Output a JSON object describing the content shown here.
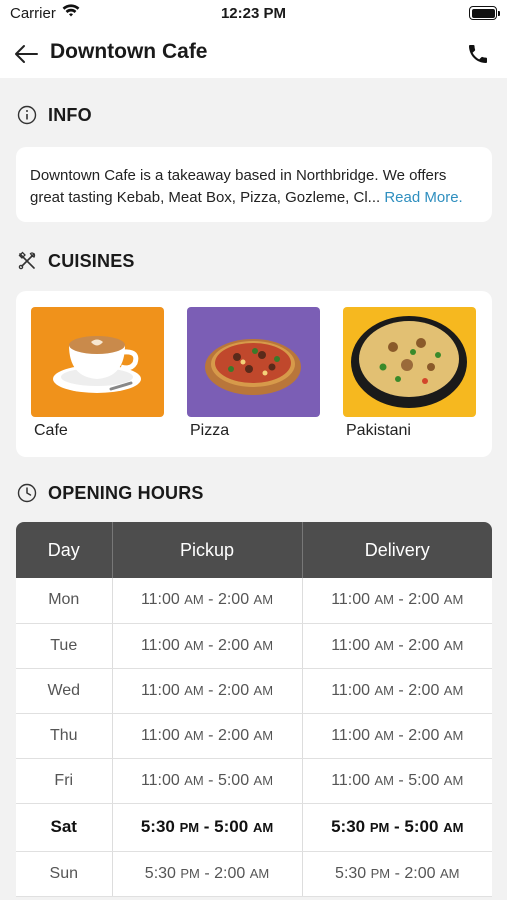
{
  "status": {
    "carrier": "Carrier",
    "time": "12:23 PM"
  },
  "header": {
    "title": "Downtown Cafe",
    "icons": {
      "back": "back-arrow-icon",
      "call": "phone-icon"
    }
  },
  "info": {
    "section_title": "INFO",
    "line1": "Downtown Cafe is a takeaway based in Northbridge. We offers",
    "line2": "great tasting Kebab, Meat Box, Pizza, Gozleme, Cl...",
    "read_more": " Read More."
  },
  "cuisines": {
    "section_title": "CUISINES",
    "items": [
      {
        "label": "Cafe",
        "bg": "#f0921b"
      },
      {
        "label": "Pizza",
        "bg": "#7b5eb5"
      },
      {
        "label": "Pakistani",
        "bg": "#f6b81f"
      }
    ]
  },
  "hours": {
    "section_title": "OPENING HOURS",
    "columns": [
      "Day",
      "Pickup",
      "Delivery"
    ],
    "rows": [
      {
        "day": "Mon",
        "pickup": "11:00 AM - 2:00 AM",
        "delivery": "11:00 AM - 2:00 AM"
      },
      {
        "day": "Tue",
        "pickup": "11:00 AM - 2:00 AM",
        "delivery": "11:00 AM - 2:00 AM"
      },
      {
        "day": "Wed",
        "pickup": "11:00 AM - 2:00 AM",
        "delivery": "11:00 AM - 2:00 AM"
      },
      {
        "day": "Thu",
        "pickup": "11:00 AM - 2:00 AM",
        "delivery": "11:00 AM - 2:00 AM"
      },
      {
        "day": "Fri",
        "pickup": "11:00 AM - 5:00 AM",
        "delivery": "11:00 AM - 5:00 AM"
      },
      {
        "day": "Sat",
        "pickup": "5:30 PM - 5:00 AM",
        "delivery": "5:30 PM - 5:00 AM",
        "today": true
      },
      {
        "day": "Sun",
        "pickup": "5:30 PM - 2:00 AM",
        "delivery": "5:30 PM - 2:00 AM"
      }
    ]
  },
  "colors": {
    "header_bg": "#4d4d4d",
    "link": "#2f8fbf",
    "page_bg": "#f2f2f2"
  }
}
